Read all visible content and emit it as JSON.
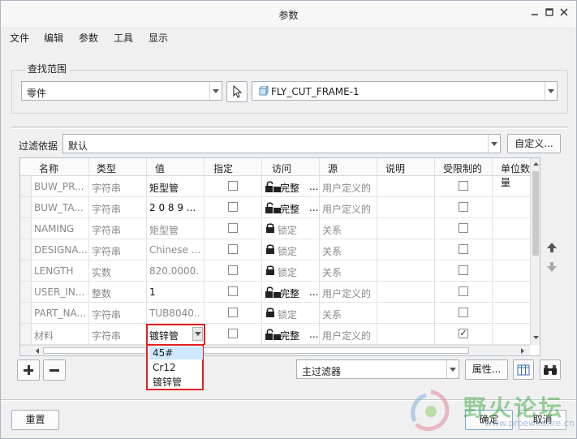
{
  "window": {
    "title": "参数",
    "min_icon": "minimize-icon",
    "max_icon": "maximize-icon",
    "close_icon": "close-icon"
  },
  "menu": [
    "文件",
    "编辑",
    "参数",
    "工具",
    "显示"
  ],
  "lookup": {
    "legend": "查找范围",
    "scope_value": "零件",
    "object_value": "FLY_CUT_FRAME-1"
  },
  "filter": {
    "label": "过滤依据",
    "value": "默认",
    "customize_button": "自定义..."
  },
  "table": {
    "headers": [
      "名称",
      "类型",
      "值",
      "指定",
      "访问",
      "源",
      "说明",
      "受限制的",
      "单位数量"
    ],
    "rows": [
      {
        "name": "BUW_PR...",
        "type": "字符串",
        "value": "矩型管",
        "designated": false,
        "access": "完整",
        "access_more": "...",
        "source": "用户定义的",
        "restricted": false,
        "editable": true
      },
      {
        "name": "BUW_TA...",
        "type": "字符串",
        "value": "2 0 8 9 ...",
        "designated": false,
        "access": "完整",
        "access_more": "...",
        "source": "用户定义的",
        "restricted": false,
        "editable": true
      },
      {
        "name": "NAMING",
        "type": "字符串",
        "value": "矩型管",
        "designated": false,
        "access": "锁定",
        "access_more": "",
        "source": "关系",
        "restricted": false,
        "editable": false
      },
      {
        "name": "DESIGNA...",
        "type": "字符串",
        "value": "Chinese ...",
        "designated": false,
        "access": "锁定",
        "access_more": "",
        "source": "关系",
        "restricted": false,
        "editable": false
      },
      {
        "name": "LENGTH",
        "type": "实数",
        "value": "820.0000...",
        "designated": false,
        "access": "锁定",
        "access_more": "",
        "source": "关系",
        "restricted": false,
        "editable": false
      },
      {
        "name": "USER_IN...",
        "type": "整数",
        "value": "1",
        "designated": false,
        "access": "完整",
        "access_more": "...",
        "source": "用户定义的",
        "restricted": false,
        "editable": true
      },
      {
        "name": "PART_NA...",
        "type": "字符串",
        "value": "TUB8040...",
        "designated": false,
        "access": "锁定",
        "access_more": "",
        "source": "关系",
        "restricted": false,
        "editable": false
      },
      {
        "name": "材料",
        "type": "字符串",
        "value": "镀锌管",
        "designated": false,
        "access": "完整",
        "access_more": "...",
        "source": "用户定义的",
        "restricted": true,
        "editable": true
      }
    ]
  },
  "dropdown_options": [
    "45#",
    "Cr12",
    "镀锌管"
  ],
  "bottom": {
    "main_filter": "主过滤器",
    "properties_button": "属性...",
    "reset_button": "重置",
    "ok_button": "确定",
    "cancel_button": "取消"
  },
  "watermark": {
    "text": "野火论坛",
    "url": "www.proewildfire.cn"
  }
}
